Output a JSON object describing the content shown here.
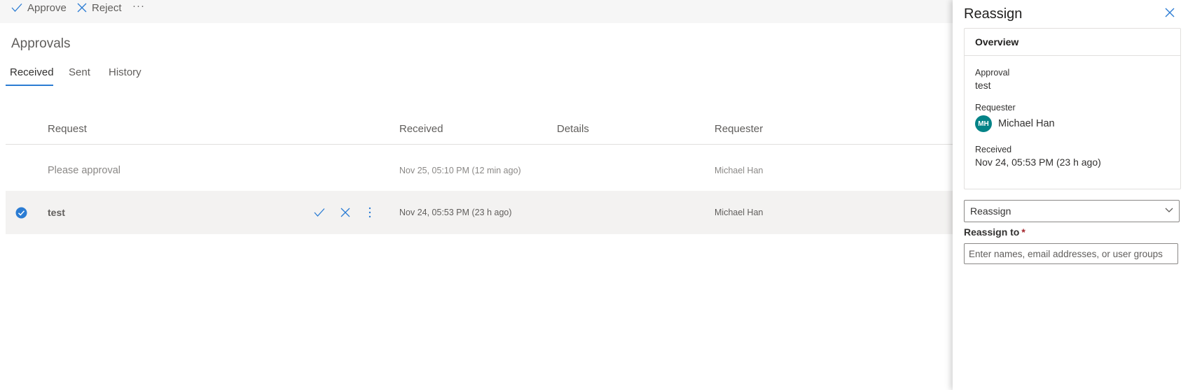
{
  "toolbar": {
    "approve_label": "Approve",
    "reject_label": "Reject",
    "more_label": "···"
  },
  "page": {
    "title": "Approvals",
    "tabs": [
      {
        "label": "Received",
        "active": true
      },
      {
        "label": "Sent",
        "active": false
      },
      {
        "label": "History",
        "active": false
      }
    ]
  },
  "table": {
    "columns": [
      "Request",
      "Received",
      "Details",
      "Requester"
    ],
    "rows": [
      {
        "request": "Please approval",
        "received": "Nov 25, 05:10 PM (12 min ago)",
        "details": "",
        "requester": "Michael Han",
        "selected": false
      },
      {
        "request": "test",
        "received": "Nov 24, 05:53 PM (23 h ago)",
        "details": "",
        "requester": "Michael Han",
        "selected": true
      }
    ]
  },
  "panel": {
    "title": "Reassign",
    "overview": {
      "heading": "Overview",
      "approval_label": "Approval",
      "approval_value": "test",
      "requester_label": "Requester",
      "requester_initials": "MH",
      "requester_name": "Michael Han",
      "received_label": "Received",
      "received_value": "Nov 24, 05:53 PM (23 h ago)"
    },
    "action_select": "Reassign",
    "reassign_to_label": "Reassign to",
    "required_marker": "*",
    "reassign_to_placeholder": "Enter names, email addresses, or user groups"
  },
  "colors": {
    "accent": "#2b7cd3",
    "avatar": "#038387",
    "required": "#a4262c"
  }
}
